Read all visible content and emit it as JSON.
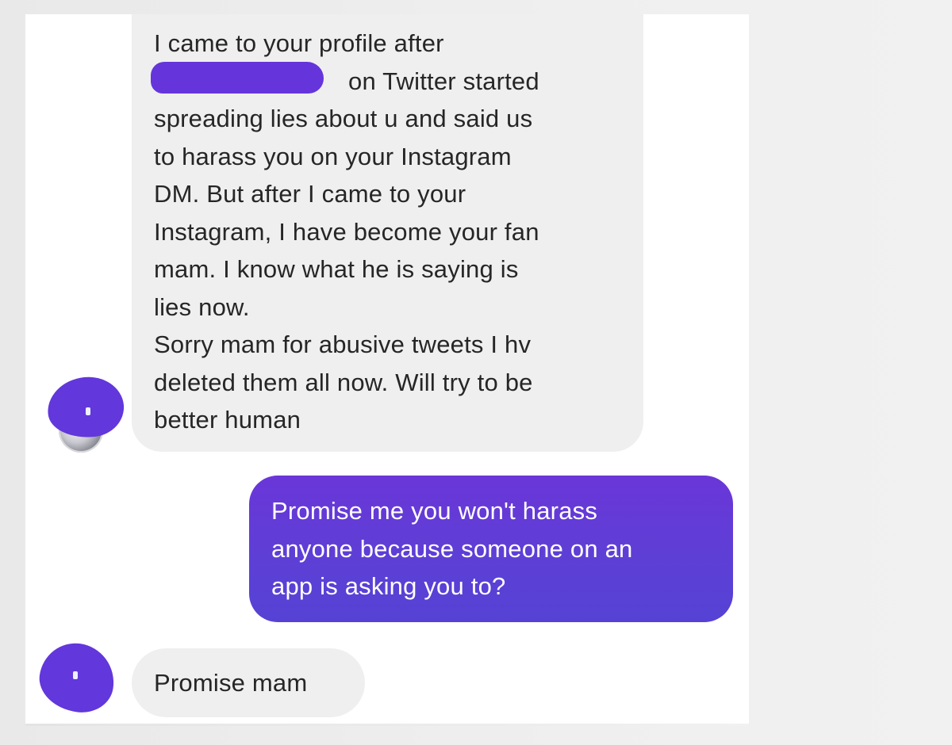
{
  "conversation": {
    "messages": [
      {
        "direction": "incoming",
        "avatar_icon": "profile-avatar-icon",
        "avatar_redacted": true,
        "lines": [
          "I came to your profile after",
          "on Twitter started",
          "spreading lies about u and said us",
          "to harass you on your Instagram",
          "DM. But after I came to your",
          "Instagram, I have become your fan",
          "mam. I know what he is saying is",
          "lies now.",
          "Sorry mam for abusive tweets I hv",
          "deleted them all now. Will try to be",
          "better human"
        ]
      },
      {
        "direction": "outgoing",
        "lines": [
          "Promise me you won't harass",
          "anyone because someone on an",
          "app is asking you to?"
        ]
      },
      {
        "direction": "incoming",
        "avatar_icon": "profile-avatar-icon",
        "avatar_redacted": true,
        "lines": [
          "Promise mam"
        ]
      }
    ]
  },
  "colors": {
    "incoming_bubble": "#efefef",
    "incoming_text": "#262626",
    "outgoing_bubble_start": "#6a36d8",
    "outgoing_bubble_end": "#5542d4",
    "outgoing_text": "#ffffff",
    "redaction": "#6237db"
  }
}
